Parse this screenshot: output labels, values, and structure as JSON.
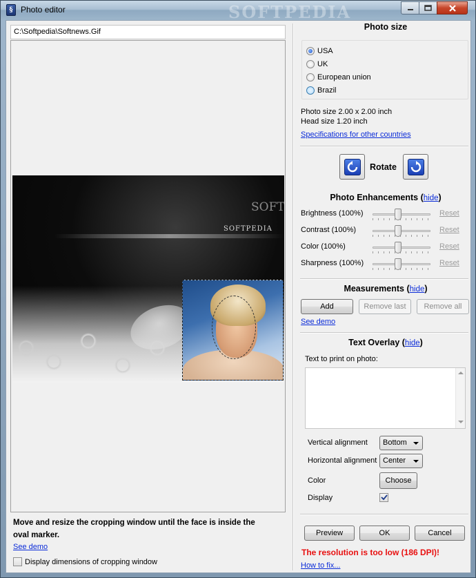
{
  "window": {
    "title": "Photo editor",
    "watermark": "SOFTPEDIA"
  },
  "left": {
    "file_path": "C:\\Softpedia\\Softnews.Gif",
    "image_logo_text": "SOFTPEDIA",
    "image_watermark": "SOFTPEDIA",
    "instructions": "Move and resize the cropping window until the face is inside the oval marker.",
    "see_demo": "See demo",
    "display_dimensions_label": "Display dimensions of cropping window",
    "display_dimensions_checked": false
  },
  "photo_size": {
    "title": "Photo size",
    "options": [
      {
        "label": "USA",
        "selected": true
      },
      {
        "label": "UK",
        "selected": false
      },
      {
        "label": "European union",
        "selected": false
      },
      {
        "label": "Brazil",
        "selected": false
      }
    ],
    "size_line": "Photo size 2.00 x 2.00 inch",
    "head_line": "Head size 1.20 inch",
    "spec_link": "Specifications for other countries"
  },
  "rotate": {
    "label": "Rotate"
  },
  "enhancements": {
    "title": "Photo Enhancements",
    "hide": "hide",
    "sliders": [
      {
        "label": "Brightness (100%)",
        "value_percent": 100,
        "reset": "Reset"
      },
      {
        "label": "Contrast (100%)",
        "value_percent": 100,
        "reset": "Reset"
      },
      {
        "label": "Color (100%)",
        "value_percent": 100,
        "reset": "Reset"
      },
      {
        "label": "Sharpness (100%)",
        "value_percent": 100,
        "reset": "Reset"
      }
    ]
  },
  "measurements": {
    "title": "Measurements",
    "hide": "hide",
    "add": "Add",
    "remove_last": "Remove last",
    "remove_all": "Remove all",
    "see_demo": "See demo"
  },
  "text_overlay": {
    "title": "Text Overlay",
    "hide": "hide",
    "text_label": "Text to print on photo:",
    "text_value": "",
    "vertical_label": "Vertical alignment",
    "vertical_value": "Bottom",
    "horizontal_label": "Horizontal alignment",
    "horizontal_value": "Center",
    "color_label": "Color",
    "choose": "Choose",
    "display_label": "Display",
    "display_checked": true
  },
  "footer": {
    "preview": "Preview",
    "ok": "OK",
    "cancel": "Cancel",
    "error": "The resolution is too low (186 DPI)!",
    "how_to_fix": "How to fix..."
  },
  "colors": {
    "error": "#e81010",
    "link": "#0a2bd8",
    "rotate_icon": "#1a3fb4"
  }
}
